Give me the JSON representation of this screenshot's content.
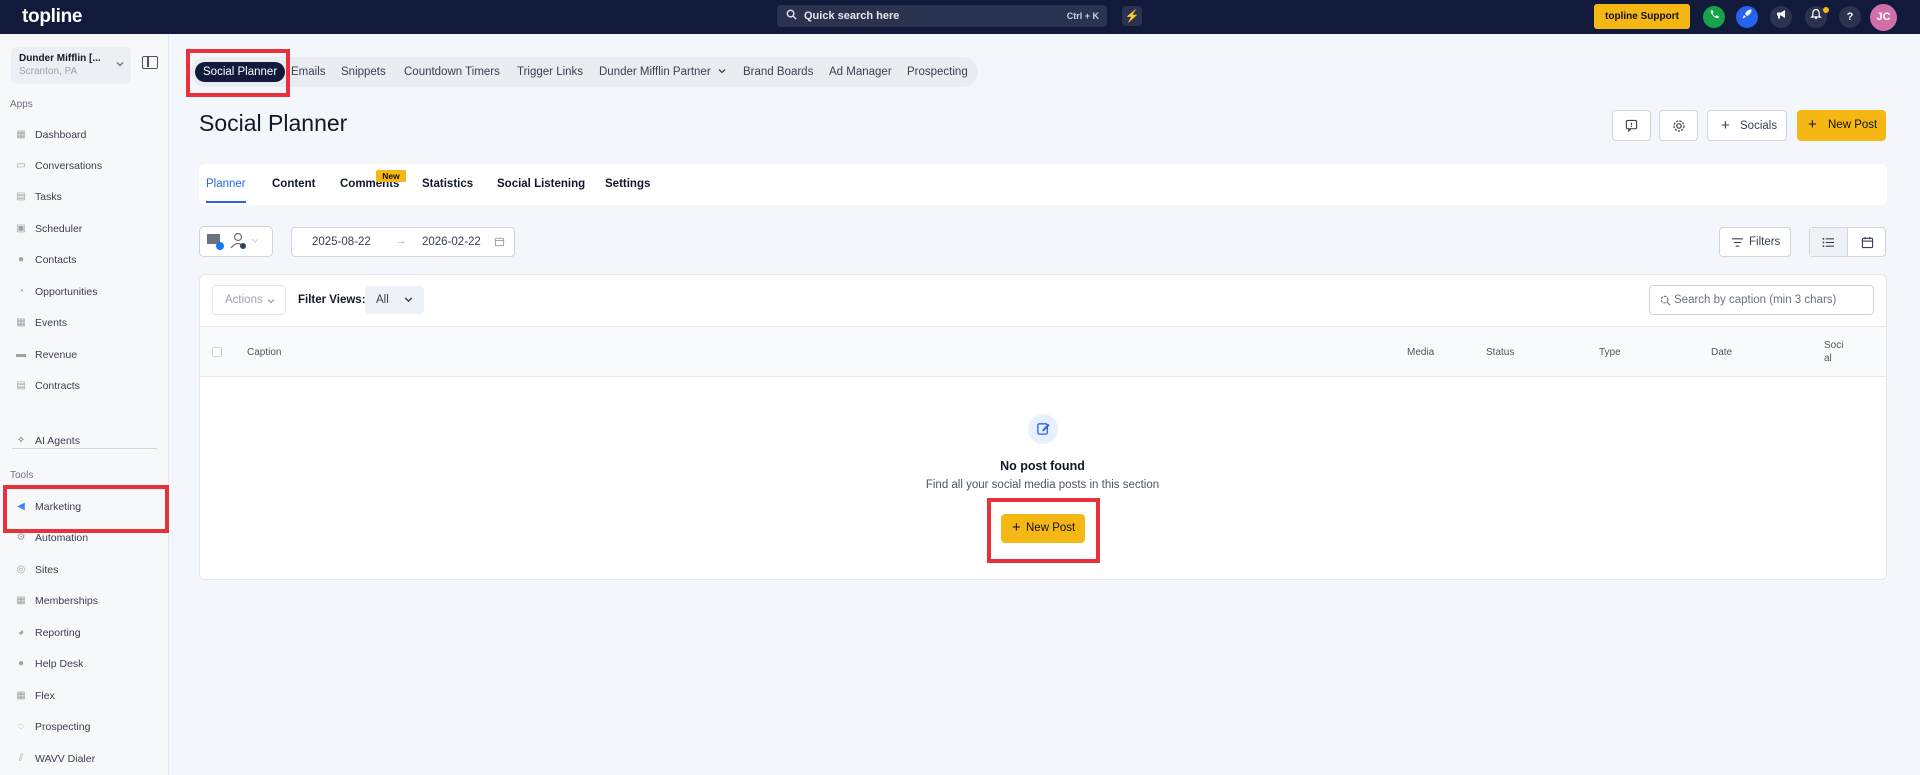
{
  "topbar": {
    "brand": "topline",
    "search_placeholder": "Quick search here",
    "search_shortcut": "Ctrl + K",
    "support_label": "topline Support",
    "avatar_initials": "JC",
    "icons": [
      "lightning-icon",
      "phone-icon",
      "rocket-icon",
      "megaphone-icon",
      "bell-icon",
      "help-icon"
    ],
    "colors": {
      "bg": "#111a3a",
      "accent": "#f5b714",
      "phone": "#16a34a",
      "rocket": "#2563eb",
      "avatar": "#d16fa9"
    }
  },
  "sidebar": {
    "location_name": "Dunder Mifflin [...",
    "location_city": "Scranton, PA",
    "apps_label": "Apps",
    "apps": [
      {
        "label": "Dashboard",
        "icon": "dashboard-icon"
      },
      {
        "label": "Conversations",
        "icon": "chat-icon"
      },
      {
        "label": "Tasks",
        "icon": "tasks-icon"
      },
      {
        "label": "Scheduler",
        "icon": "calendar-icon"
      },
      {
        "label": "Contacts",
        "icon": "contacts-icon"
      },
      {
        "label": "Opportunities",
        "icon": "opportunities-icon"
      },
      {
        "label": "Events",
        "icon": "events-icon"
      },
      {
        "label": "Revenue",
        "icon": "revenue-icon"
      },
      {
        "label": "Contracts",
        "icon": "contracts-icon"
      }
    ],
    "ai_agents": "AI Agents",
    "tools_label": "Tools",
    "tools": [
      {
        "label": "Marketing",
        "icon": "megaphone-icon",
        "active": true
      },
      {
        "label": "Automation",
        "icon": "automation-icon"
      },
      {
        "label": "Sites",
        "icon": "sites-icon"
      },
      {
        "label": "Memberships",
        "icon": "memberships-icon"
      },
      {
        "label": "Reporting",
        "icon": "reporting-icon"
      },
      {
        "label": "Help Desk",
        "icon": "helpdesk-icon"
      },
      {
        "label": "Flex",
        "icon": "flex-icon"
      },
      {
        "label": "Prospecting",
        "icon": "prospecting-icon"
      },
      {
        "label": "WAVV Dialer",
        "icon": "dialer-icon"
      }
    ]
  },
  "app_tabs": [
    "Social Planner",
    "Emails",
    "Snippets",
    "Countdown Timers",
    "Trigger Links",
    "Dunder Mifflin Partner",
    "Brand Boards",
    "Ad Manager",
    "Prospecting"
  ],
  "header": {
    "title": "Social Planner",
    "socials_label": "Socials",
    "new_post_label": "New Post"
  },
  "sub_tabs": [
    "Planner",
    "Content",
    "Comments",
    "Statistics",
    "Social Listening",
    "Settings"
  ],
  "new_badge": "New",
  "date_range": {
    "start": "2025-08-22",
    "end": "2026-02-22"
  },
  "filters_label": "Filters",
  "table": {
    "actions_label": "Actions",
    "filter_views_label": "Filter Views:",
    "filter_views_value": "All",
    "search_placeholder": "Search by caption (min 3 chars)",
    "columns": [
      "Caption",
      "Media",
      "Status",
      "Type",
      "Date",
      "Soci al"
    ]
  },
  "empty_state": {
    "title": "No post found",
    "subtitle": "Find all your social media posts in this section",
    "button": "New Post"
  }
}
